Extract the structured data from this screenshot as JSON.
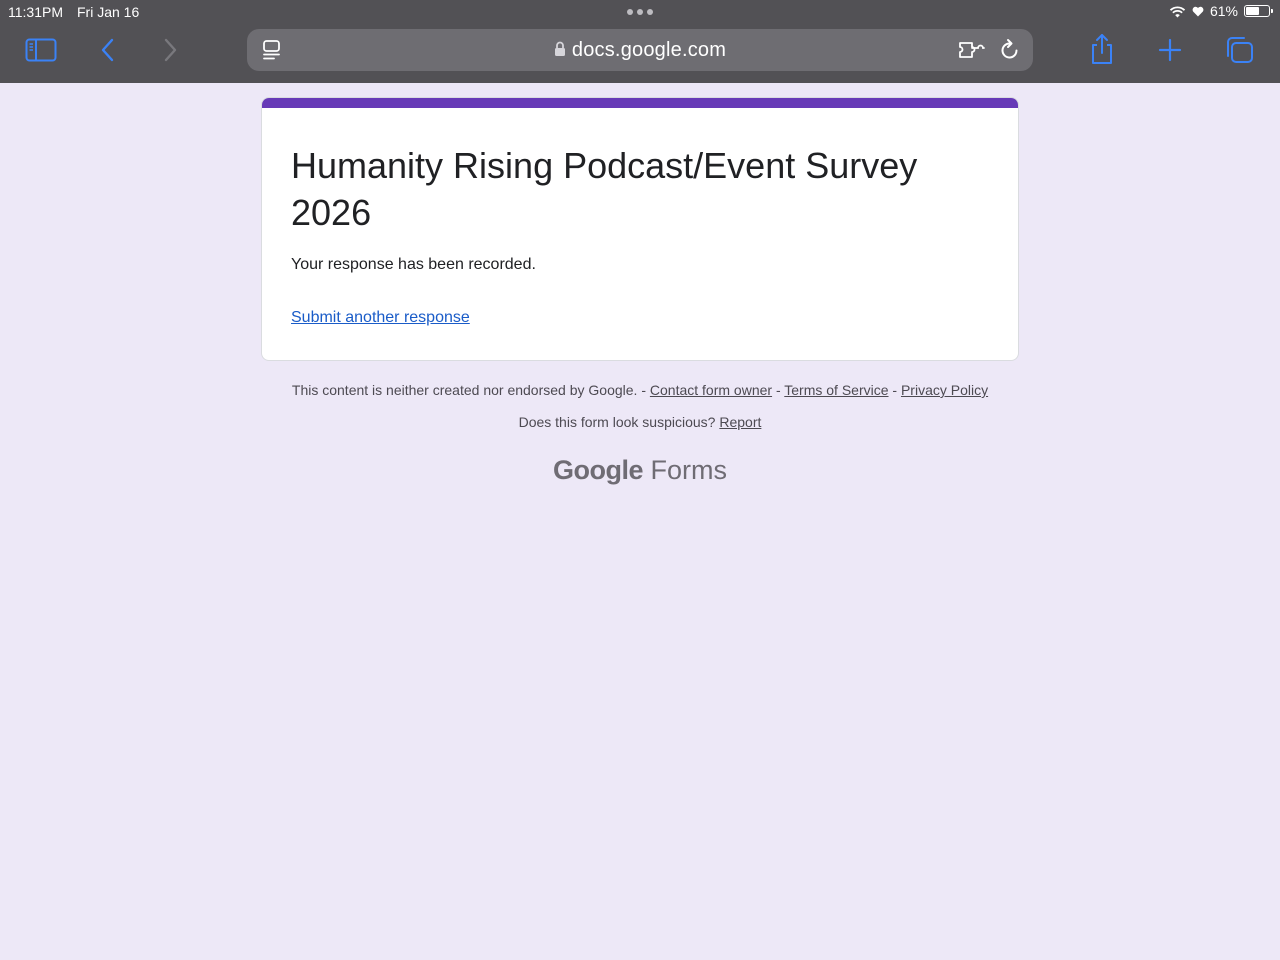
{
  "status_bar": {
    "time": "11:31PM",
    "date": "Fri Jan 16",
    "battery_percent": "61%",
    "battery_level": 0.61
  },
  "browser": {
    "url": "docs.google.com",
    "icons": {
      "sidebar": "sidebar-icon",
      "back": "chevron-left-icon",
      "forward": "chevron-right-icon",
      "page_menu": "page-menu-icon",
      "extensions": "puzzle-icon",
      "reload": "reload-icon",
      "share": "share-icon",
      "new_tab": "plus-icon",
      "tabs": "tabs-icon"
    },
    "accent_color": "#3b82f6"
  },
  "form": {
    "accent_color": "#673ab7",
    "title": "Humanity Rising Podcast/Event Survey 2026",
    "message": "Your response has been recorded.",
    "submit_another": "Submit another response"
  },
  "footer": {
    "disclaimer": "This content is neither created nor endorsed by Google.",
    "separator": "-",
    "contact_owner": "Contact form owner",
    "terms": "Terms of Service",
    "privacy": "Privacy Policy",
    "suspicious_question": "Does this form look suspicious?",
    "report": "Report",
    "brand_google": "Google",
    "brand_forms": "Forms"
  }
}
